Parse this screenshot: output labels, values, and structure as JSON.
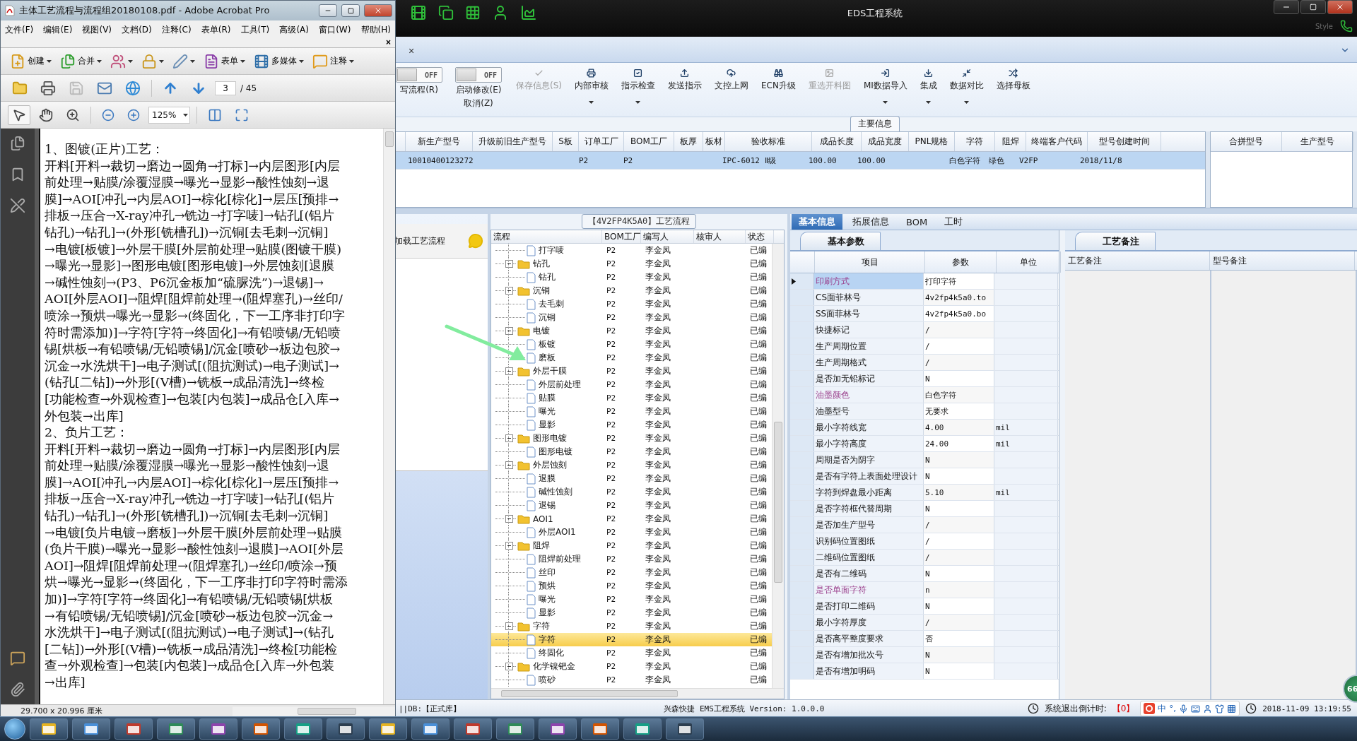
{
  "acrobat": {
    "title": "主体工艺流程与流程组20180108.pdf - Adobe Acrobat Pro",
    "menus": [
      "文件(F)",
      "编辑(E)",
      "视图(V)",
      "文档(D)",
      "注释(C)",
      "表单(R)",
      "工具(T)",
      "高级(A)",
      "窗口(W)",
      "帮助(H)"
    ],
    "menu_close": "×",
    "task_buttons": [
      "创建",
      "合并",
      "表单",
      "多媒体",
      "注释"
    ],
    "page": {
      "value": "3",
      "total": "/ 45"
    },
    "tools": [
      {
        "selected": true
      },
      {
        "selected": false
      },
      {
        "selected": false
      }
    ],
    "zoom": {
      "value": "125%"
    },
    "document": {
      "lines": [
        "1、图镀(正片)工艺：",
        "开料[开料→裁切→磨边→圆角→打标]→内层图形[内层",
        "前处理→贴膜/涂覆湿膜→曝光→显影→酸性蚀刻→退",
        "膜]→AOI[冲孔→内层AOI]→棕化[棕化]→层压[预排→",
        "排板→压合→X-ray冲孔→铣边→打字唛]→钻孔[(铝片",
        "钻孔)→钻孔]→(外形[铣槽孔])→沉铜[去毛刺→沉铜]",
        "→电镀[板镀]→外层干膜[外层前处理→贴膜(图镀干膜)",
        "→曝光→显影]→图形电镀[图形电镀]→外层蚀刻[退膜",
        "→碱性蚀刻→(P3、P6沉金板加“硫脲洗”)→退锡]→",
        "AOI[外层AOI]→阻焊[阻焊前处理→(阻焊塞孔)→丝印/",
        "喷涂→预烘→曝光→显影→(终固化，下一工序非打印字",
        "符时需添加)]→字符[字符→终固化]→有铅喷锡/无铅喷",
        "锡[烘板→有铅喷锡/无铅喷锡]/沉金[喷砂→板边包胶→",
        "沉金→水洗烘干]→电子测试[(阻抗测试)→电子测试]→",
        "(钻孔[二钻])→外形[(V槽)→铣板→成品清洗]→终检",
        "[功能检查→外观检查]→包装[内包装]→成品仓[入库→",
        "外包装→出库]",
        "2、负片工艺：",
        "开料[开料→裁切→磨边→圆角→打标]→内层图形[内层",
        "前处理→贴膜/涂覆湿膜→曝光→显影→酸性蚀刻→退",
        "膜]→AOI[冲孔→内层AOI]→棕化[棕化]→层压[预排→",
        "排板→压合→X-ray冲孔→铣边→打字唛]→钻孔[(铝片",
        "钻孔)→钻孔]→(外形[铣槽孔])→沉铜[去毛刺→沉铜]",
        "→电镀[负片电镀→磨板]→外层干膜[外层前处理→贴膜",
        "(负片干膜)→曝光→显影→酸性蚀刻→退膜]→AOI[外层",
        "AOI]→阻焊[阻焊前处理→(阻焊塞孔)→丝印/喷涂→预",
        "烘→曝光→显影→(终固化，下一工序非打印字符时需添",
        "加)]→字符[字符→终固化]→有铅喷锡/无铅喷锡[烘板",
        "→有铅喷锡/无铅喷锡]/沉金[喷砂→板边包胶→沉金→",
        "水洗烘干]→电子测试[(阻抗测试)→电子测试]→(钻孔",
        "[二钻])→外形[(V槽)→铣板→成品清洗]→终检[功能检",
        "查→外观检查]→包装[内包装]→成品仓[入库→外包装",
        "→出库]"
      ]
    },
    "page_size": "29.700 x 20.996 厘米"
  },
  "eds": {
    "title": "EDS工程系统",
    "style_label": "Style",
    "tab_close": "×",
    "toggles": [
      {
        "label": "写流程(R)",
        "on": false,
        "state": "OFF"
      },
      {
        "label": "启动修改(E)",
        "sublabel": "取消(Z)",
        "on": false,
        "state": "OFF"
      }
    ],
    "actions": [
      {
        "label": "保存信息(S)",
        "disabled": true,
        "dropdown": false
      },
      {
        "label": "内部审核",
        "disabled": false,
        "dropdown": true
      },
      {
        "label": "指示检查",
        "disabled": false,
        "dropdown": true
      },
      {
        "label": "发送指示",
        "disabled": false,
        "dropdown": false
      },
      {
        "label": "文控上网",
        "disabled": false,
        "dropdown": false
      },
      {
        "label": "ECN升级",
        "disabled": false,
        "dropdown": false
      },
      {
        "label": "重选开料图",
        "disabled": true,
        "dropdown": false
      },
      {
        "label": "MI数据导入",
        "disabled": false,
        "dropdown": true
      },
      {
        "label": "集成",
        "disabled": false,
        "dropdown": true
      },
      {
        "label": "数据对比",
        "disabled": false,
        "dropdown": true
      },
      {
        "label": "选择母板",
        "disabled": false,
        "dropdown": false
      }
    ],
    "main_info": {
      "title": "主要信息",
      "columns": [
        "新生产型号",
        "升级前旧生产型号",
        "S板",
        "订单工厂",
        "BOM工厂",
        "板厚",
        "板材",
        "验收标准",
        "成品长度",
        "成品宽度",
        "PNL规格",
        "字符",
        "阻焊",
        "终端客户代码",
        "型号创建时间"
      ],
      "rows": [
        {
          "selected": true,
          "cells": [
            "10010400123272",
            null,
            null,
            "P2",
            "P2",
            null,
            null,
            "IPC-6012 Ⅱ级",
            "100.00",
            "100.00",
            null,
            "白色字符",
            "绿色",
            "V2FP",
            "2018/11/8"
          ]
        }
      ],
      "merge_columns": [
        "合拼型号",
        "生产型号"
      ]
    },
    "flow": {
      "load_label": "加载工艺流程",
      "title": "【4V2FP4K5A0】工艺流程",
      "columns": [
        "流程",
        "BOM工厂",
        "编写人",
        "核审人",
        "状态"
      ],
      "tree": [
        {
          "label": "打字唛",
          "kind": "file",
          "bom": "P2",
          "writer": "李金凤",
          "status": "已编",
          "selected": false
        },
        {
          "label": "钻孔",
          "kind": "folder",
          "expanded": true,
          "bom": "P2",
          "writer": "李金凤",
          "status": "已编",
          "selected": false,
          "children": [
            {
              "label": "钻孔",
              "kind": "file",
              "bom": "P2",
              "writer": "李金凤",
              "status": "已编",
              "selected": false
            }
          ]
        },
        {
          "label": "沉铜",
          "kind": "folder",
          "expanded": true,
          "bom": "P2",
          "writer": "李金凤",
          "status": "已编",
          "selected": false,
          "children": [
            {
              "label": "去毛刺",
              "kind": "file",
              "bom": "P2",
              "writer": "李金凤",
              "status": "已编",
              "selected": false
            },
            {
              "label": "沉铜",
              "kind": "file",
              "bom": "P2",
              "writer": "李金凤",
              "status": "已编",
              "selected": false
            }
          ]
        },
        {
          "label": "电镀",
          "kind": "folder",
          "expanded": true,
          "bom": "P2",
          "writer": "李金凤",
          "status": "已编",
          "selected": false,
          "children": [
            {
              "label": "板镀",
              "kind": "file",
              "bom": "P2",
              "writer": "李金凤",
              "status": "已编",
              "selected": false
            },
            {
              "label": "磨板",
              "kind": "file",
              "bom": "P2",
              "writer": "李金凤",
              "status": "已编",
              "selected": false
            }
          ]
        },
        {
          "label": "外层干膜",
          "kind": "folder",
          "expanded": true,
          "bom": "P2",
          "writer": "李金凤",
          "status": "已编",
          "selected": false,
          "children": [
            {
              "label": "外层前处理",
              "kind": "file",
              "bom": "P2",
              "writer": "李金凤",
              "status": "已编",
              "selected": false
            },
            {
              "label": "贴膜",
              "kind": "file",
              "bom": "P2",
              "writer": "李金凤",
              "status": "已编",
              "selected": false
            },
            {
              "label": "曝光",
              "kind": "file",
              "bom": "P2",
              "writer": "李金凤",
              "status": "已编",
              "selected": false
            },
            {
              "label": "显影",
              "kind": "file",
              "bom": "P2",
              "writer": "李金凤",
              "status": "已编",
              "selected": false
            }
          ]
        },
        {
          "label": "图形电镀",
          "kind": "folder",
          "expanded": true,
          "bom": "P2",
          "writer": "李金凤",
          "status": "已编",
          "selected": false,
          "children": [
            {
              "label": "图形电镀",
              "kind": "file",
              "bom": "P2",
              "writer": "李金凤",
              "status": "已编",
              "selected": false
            }
          ]
        },
        {
          "label": "外层蚀刻",
          "kind": "folder",
          "expanded": true,
          "bom": "P2",
          "writer": "李金凤",
          "status": "已编",
          "selected": false,
          "children": [
            {
              "label": "退膜",
              "kind": "file",
              "bom": "P2",
              "writer": "李金凤",
              "status": "已编",
              "selected": false
            },
            {
              "label": "碱性蚀刻",
              "kind": "file",
              "bom": "P2",
              "writer": "李金凤",
              "status": "已编",
              "selected": false
            },
            {
              "label": "退锡",
              "kind": "file",
              "bom": "P2",
              "writer": "李金凤",
              "status": "已编",
              "selected": false
            }
          ]
        },
        {
          "label": "AOI1",
          "kind": "folder",
          "expanded": true,
          "bom": "P2",
          "writer": "李金凤",
          "status": "已编",
          "selected": false,
          "children": [
            {
              "label": "外层AOI1",
              "kind": "file",
              "bom": "P2",
              "writer": "李金凤",
              "status": "已编",
              "selected": false
            }
          ]
        },
        {
          "label": "阻焊",
          "kind": "folder",
          "expanded": true,
          "bom": "P2",
          "writer": "李金凤",
          "status": "已编",
          "selected": false,
          "children": [
            {
              "label": "阻焊前处理",
              "kind": "file",
              "bom": "P2",
              "writer": "李金凤",
              "status": "已编",
              "selected": false
            },
            {
              "label": "丝印",
              "kind": "file",
              "bom": "P2",
              "writer": "李金凤",
              "status": "已编",
              "selected": false
            },
            {
              "label": "预烘",
              "kind": "file",
              "bom": "P2",
              "writer": "李金凤",
              "status": "已编",
              "selected": false
            },
            {
              "label": "曝光",
              "kind": "file",
              "bom": "P2",
              "writer": "李金凤",
              "status": "已编",
              "selected": false
            },
            {
              "label": "显影",
              "kind": "file",
              "bom": "P2",
              "writer": "李金凤",
              "status": "已编",
              "selected": false
            }
          ]
        },
        {
          "label": "字符",
          "kind": "folder",
          "expanded": true,
          "bom": "P2",
          "writer": "李金凤",
          "status": "已编",
          "selected": false,
          "children": [
            {
              "label": "字符",
              "kind": "file",
              "bom": "P2",
              "writer": "李金凤",
              "status": "已编",
              "selected": true
            },
            {
              "label": "终固化",
              "kind": "file",
              "bom": "P2",
              "writer": "李金凤",
              "status": "已编",
              "selected": false
            }
          ]
        },
        {
          "label": "化学镍钯金",
          "kind": "folder",
          "expanded": true,
          "bom": "P2",
          "writer": "李金凤",
          "status": "已编",
          "selected": false,
          "children": [
            {
              "label": "喷砂",
              "kind": "file",
              "bom": "P2",
              "writer": "李金凤",
              "status": "已编",
              "selected": false
            }
          ]
        }
      ]
    },
    "details": {
      "tabs": [
        {
          "label": "基本信息",
          "selected": true
        },
        {
          "label": "拓展信息",
          "selected": false
        },
        {
          "label": "BOM",
          "selected": false
        },
        {
          "label": "工时",
          "selected": false
        }
      ],
      "params": {
        "tab": "基本参数",
        "columns": [
          "项目",
          "参数",
          "单位"
        ],
        "rows": [
          {
            "name": "印刷方式",
            "value": "打印字符",
            "flagged": true,
            "selected": true
          },
          {
            "name": "CS面菲林号",
            "value": "4v2fp4k5a0.to",
            "flagged": false,
            "selected": false
          },
          {
            "name": "SS面菲林号",
            "value": "4v2fp4k5a0.bo",
            "flagged": false,
            "selected": false
          },
          {
            "name": "快捷标记",
            "value": "/",
            "flagged": false,
            "selected": false
          },
          {
            "name": "生产周期位置",
            "value": "/",
            "flagged": false,
            "selected": false
          },
          {
            "name": "生产周期格式",
            "value": "/",
            "flagged": false,
            "selected": false
          },
          {
            "name": "是否加无铅标记",
            "value": "N",
            "flagged": false,
            "selected": false
          },
          {
            "name": "油墨颜色",
            "value": "白色字符",
            "flagged": true,
            "selected": false
          },
          {
            "name": "油墨型号",
            "value": "无要求",
            "flagged": false,
            "selected": false
          },
          {
            "name": "最小字符线宽",
            "value": "4.00",
            "unit": "mil",
            "flagged": false,
            "selected": false
          },
          {
            "name": "最小字符高度",
            "value": "24.00",
            "unit": "mil",
            "flagged": false,
            "selected": false
          },
          {
            "name": "周期是否为阴字",
            "value": "N",
            "flagged": false,
            "selected": false
          },
          {
            "name": "是否有字符上表面处理设计",
            "value": "N",
            "flagged": false,
            "selected": false
          },
          {
            "name": "字符到焊盘最小距离",
            "value": "5.10",
            "unit": "mil",
            "flagged": false,
            "selected": false
          },
          {
            "name": "是否字符框代替周期",
            "value": "N",
            "flagged": false,
            "selected": false
          },
          {
            "name": "是否加生产型号",
            "value": "/",
            "flagged": false,
            "selected": false
          },
          {
            "name": "识别码位置图纸",
            "value": "/",
            "flagged": false,
            "selected": false
          },
          {
            "name": "二维码位置图纸",
            "value": "/",
            "flagged": false,
            "selected": false
          },
          {
            "name": "是否有二维码",
            "value": "N",
            "flagged": false,
            "selected": false
          },
          {
            "name": "是否单面字符",
            "value": "n",
            "flagged": true,
            "selected": false
          },
          {
            "name": "是否打印二维码",
            "value": "N",
            "flagged": false,
            "selected": false
          },
          {
            "name": "最小字符厚度",
            "value": "/",
            "flagged": false,
            "selected": false
          },
          {
            "name": "是否高平整度要求",
            "value": "否",
            "flagged": false,
            "selected": false
          },
          {
            "name": "是否有增加批次号",
            "value": "N",
            "flagged": false,
            "selected": false
          },
          {
            "name": "是否有增加明码",
            "value": "N",
            "flagged": false,
            "selected": false
          }
        ]
      },
      "notes": {
        "tab": "工艺备注",
        "columns": [
          "工艺备注",
          "型号备注"
        ]
      }
    },
    "status": {
      "db": "||DB:【正式库】",
      "app": "兴森快捷 EMS工程系统 Version: 1.0.0.0",
      "countdown_label": "系统退出倒计时:",
      "countdown": "【0】",
      "datetime": "2018-11-09 13:19:55"
    }
  },
  "ime": {
    "mode": "中",
    "punct": "°,"
  },
  "badge": "66"
}
